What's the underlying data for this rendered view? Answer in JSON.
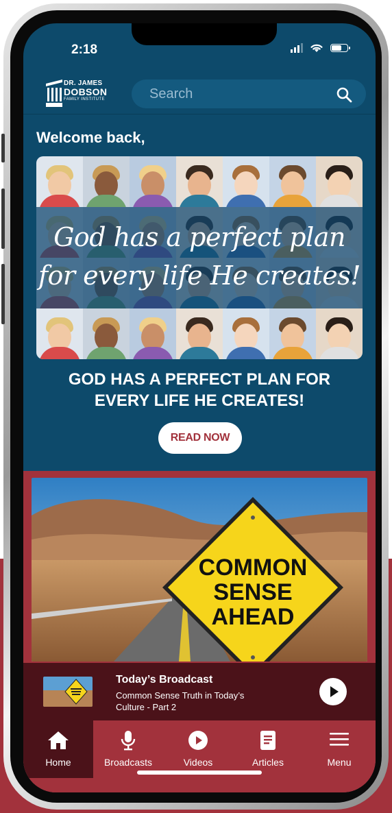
{
  "status": {
    "time": "2:18"
  },
  "header": {
    "logo": {
      "line1": "DR. JAMES",
      "line2": "DOBSON",
      "line3": "FAMILY INSTITUTE"
    },
    "search_placeholder": "Search",
    "search_icon": "search-icon"
  },
  "welcome": "Welcome back,",
  "banner": {
    "script_line1": "God has a perfect plan",
    "script_line2": "for every life He creates!"
  },
  "headline": "GOD HAS A PERFECT PLAN FOR EVERY LIFE HE CREATES!",
  "read_now": "READ NOW",
  "feature_sign": {
    "line1": "COMMON",
    "line2": "SENSE",
    "line3": "AHEAD"
  },
  "player": {
    "title": "Today’s Broadcast",
    "subtitle": "Common Sense Truth in Today’s Culture - Part 2"
  },
  "tabs": [
    {
      "label": "Home",
      "icon": "home-icon",
      "active": true
    },
    {
      "label": "Broadcasts",
      "icon": "microphone-icon"
    },
    {
      "label": "Videos",
      "icon": "play-circle-icon"
    },
    {
      "label": "Articles",
      "icon": "document-icon"
    },
    {
      "label": "Menu",
      "icon": "hamburger-menu-icon"
    }
  ],
  "colors": {
    "navy": "#0d4a6b",
    "crimson": "#a2323c",
    "maroon": "#4b1219",
    "sign_yellow": "#f6d51b"
  }
}
